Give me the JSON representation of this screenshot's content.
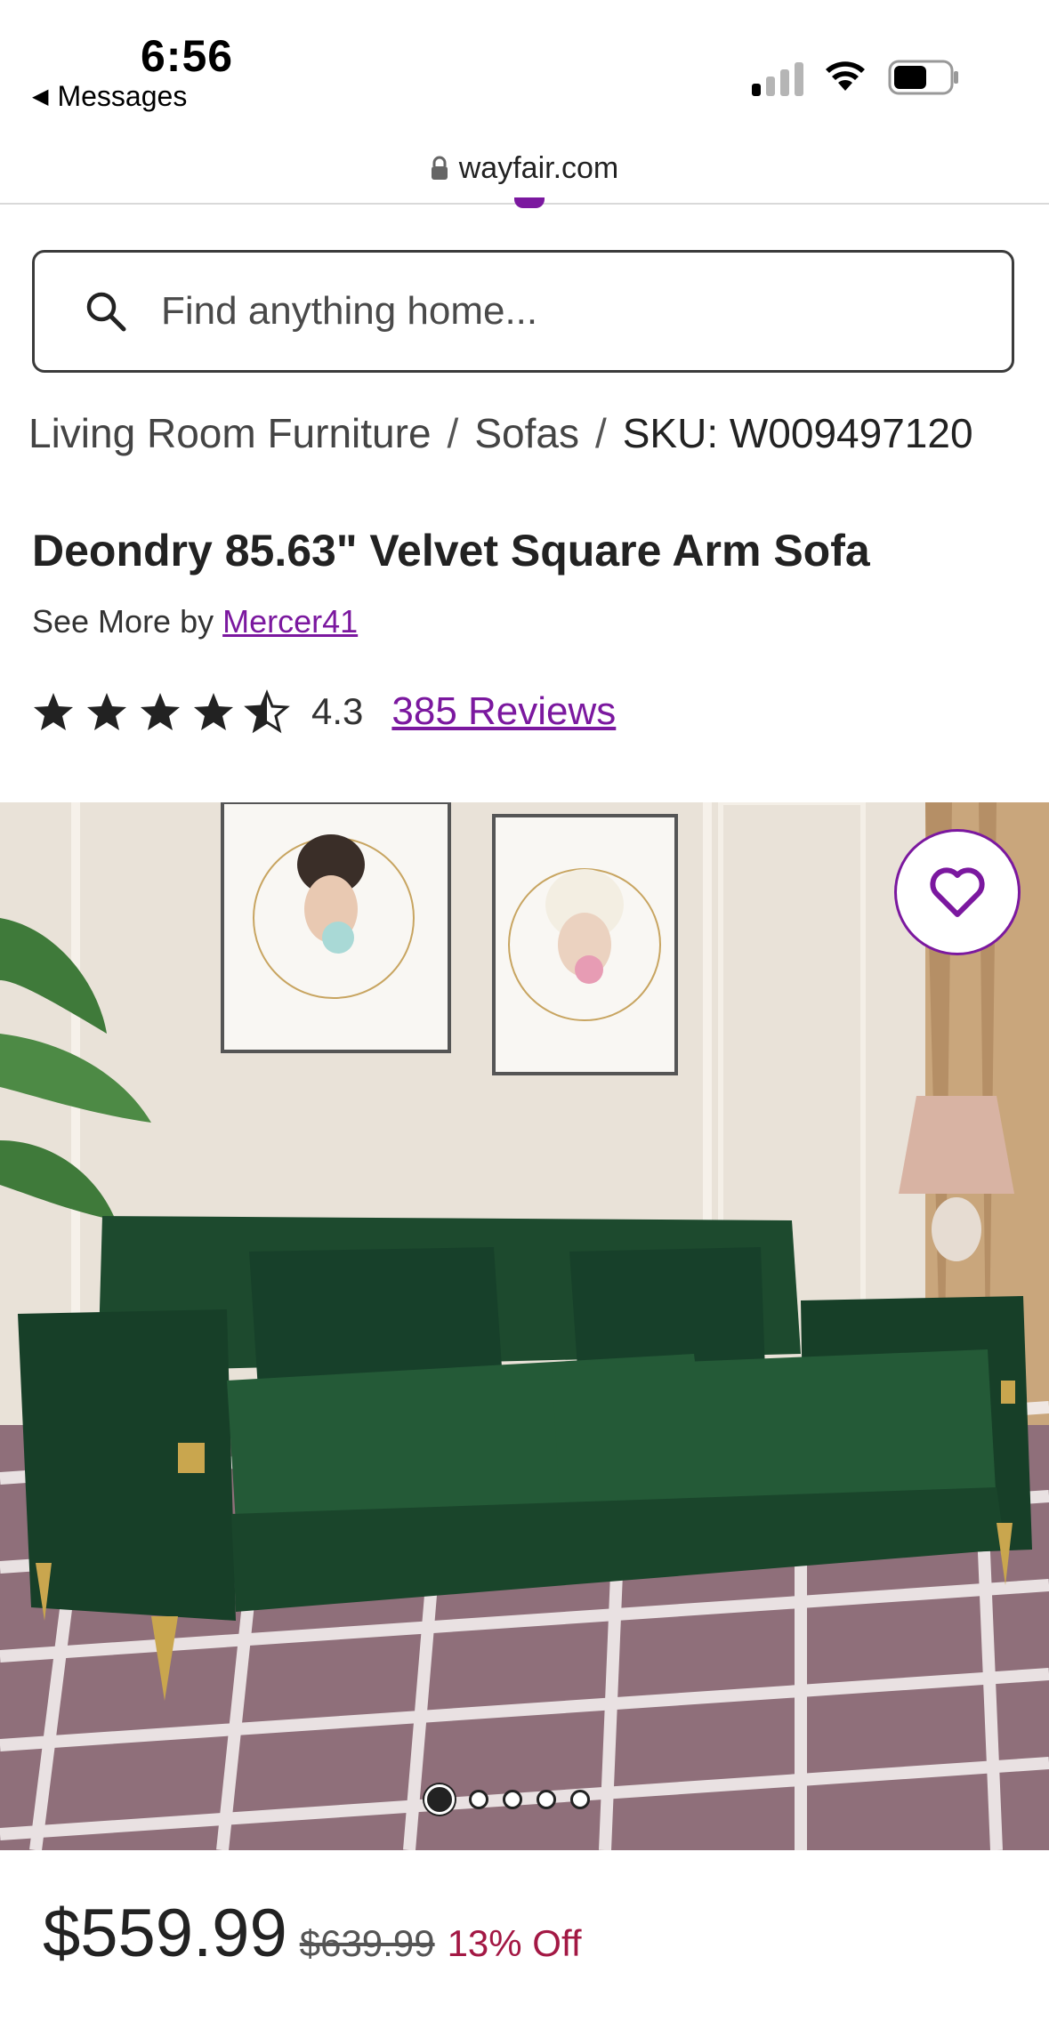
{
  "status_bar": {
    "time": "6:56",
    "back_label": "Messages",
    "signal_bars_filled": 1,
    "battery_level": 0.45
  },
  "url_bar": {
    "domain": "wayfair.com",
    "lock_icon": "lock-icon"
  },
  "search": {
    "placeholder": "Find anything home...",
    "icon": "search-icon"
  },
  "breadcrumb": {
    "items": [
      "Living Room Furniture",
      "Sofas",
      "SKU: W009497120"
    ],
    "separator": "/"
  },
  "product": {
    "title": "Deondry 85.63\" Velvet Square Arm Sofa",
    "see_more_prefix": "See More by",
    "brand": "Mercer41",
    "rating": "4.3",
    "rating_stars": 4.5,
    "reviews_label": "385 Reviews",
    "favorite_icon": "heart-icon"
  },
  "carousel": {
    "dot_count": 5,
    "active_index": 0
  },
  "pricing": {
    "price": "$559.99",
    "original_price": "$639.99",
    "discount": "13% Off"
  },
  "colors": {
    "brand_purple": "#7b189f",
    "discount_red": "#a31844",
    "sofa_green": "#1d4a2e"
  }
}
